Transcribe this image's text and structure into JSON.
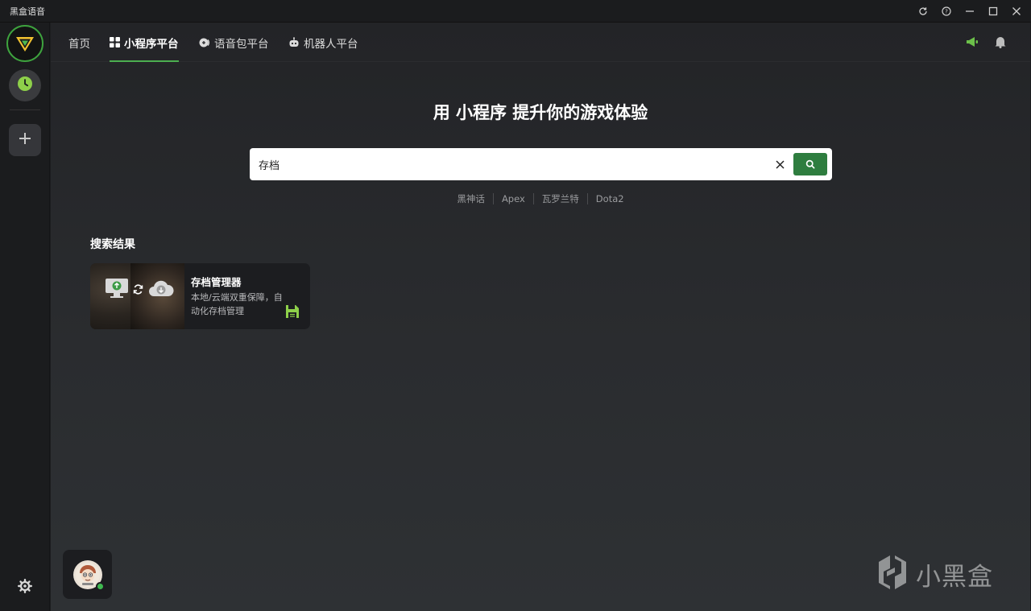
{
  "window": {
    "title": "黑盒语音",
    "controls": [
      "refresh-icon",
      "help-icon",
      "minimize-icon",
      "maximize-icon",
      "close-icon"
    ]
  },
  "sidebar": {
    "logo_icon": "heybox-logo-icon",
    "items": [
      {
        "icon": "clock-icon",
        "accent": "#8ed04a"
      },
      {
        "icon": "plus-icon"
      }
    ],
    "settings_icon": "gear-icon"
  },
  "nav": {
    "tabs": [
      {
        "label": "首页",
        "icon": ""
      },
      {
        "label": "小程序平台",
        "icon": "grid-icon",
        "active": true
      },
      {
        "label": "语音包平台",
        "icon": "voice-icon"
      },
      {
        "label": "机器人平台",
        "icon": "robot-icon"
      }
    ],
    "right_icons": [
      "megaphone-icon",
      "bell-icon"
    ]
  },
  "hero": {
    "title": "用 小程序 提升你的游戏体验"
  },
  "search": {
    "value": "存档",
    "placeholder": "",
    "button_color": "#2e7d3f"
  },
  "tags": [
    "黑神话",
    "Apex",
    "瓦罗兰特",
    "Dota2"
  ],
  "results": {
    "heading": "搜索结果",
    "items": [
      {
        "title": "存档管理器",
        "description": "本地/云端双重保障，自动化存档管理",
        "action_icon": "save-icon",
        "action_color": "#8ed04a"
      }
    ]
  },
  "user": {
    "avatar_icon": "avatar-icon",
    "status": "online",
    "status_color": "#3fb950"
  },
  "watermark": {
    "text": "小黑盒"
  },
  "colors": {
    "accent": "#4caf50",
    "background": "#232427"
  }
}
